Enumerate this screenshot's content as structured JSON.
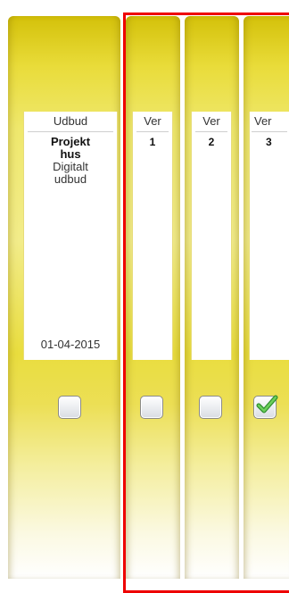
{
  "binders": [
    {
      "header": "Udbud",
      "title": "Projekt hus",
      "subtitle": "Digitalt udbud",
      "date": "01-04-2015",
      "checked": false
    },
    {
      "header": "Ver",
      "number": "1",
      "checked": false
    },
    {
      "header": "Ver",
      "number": "2",
      "checked": false
    },
    {
      "header": "Ver",
      "number": "3",
      "checked": true
    }
  ],
  "colors": {
    "binder": "#e9dc3a",
    "selection": "#ee0000",
    "check": "#3fae3f"
  }
}
